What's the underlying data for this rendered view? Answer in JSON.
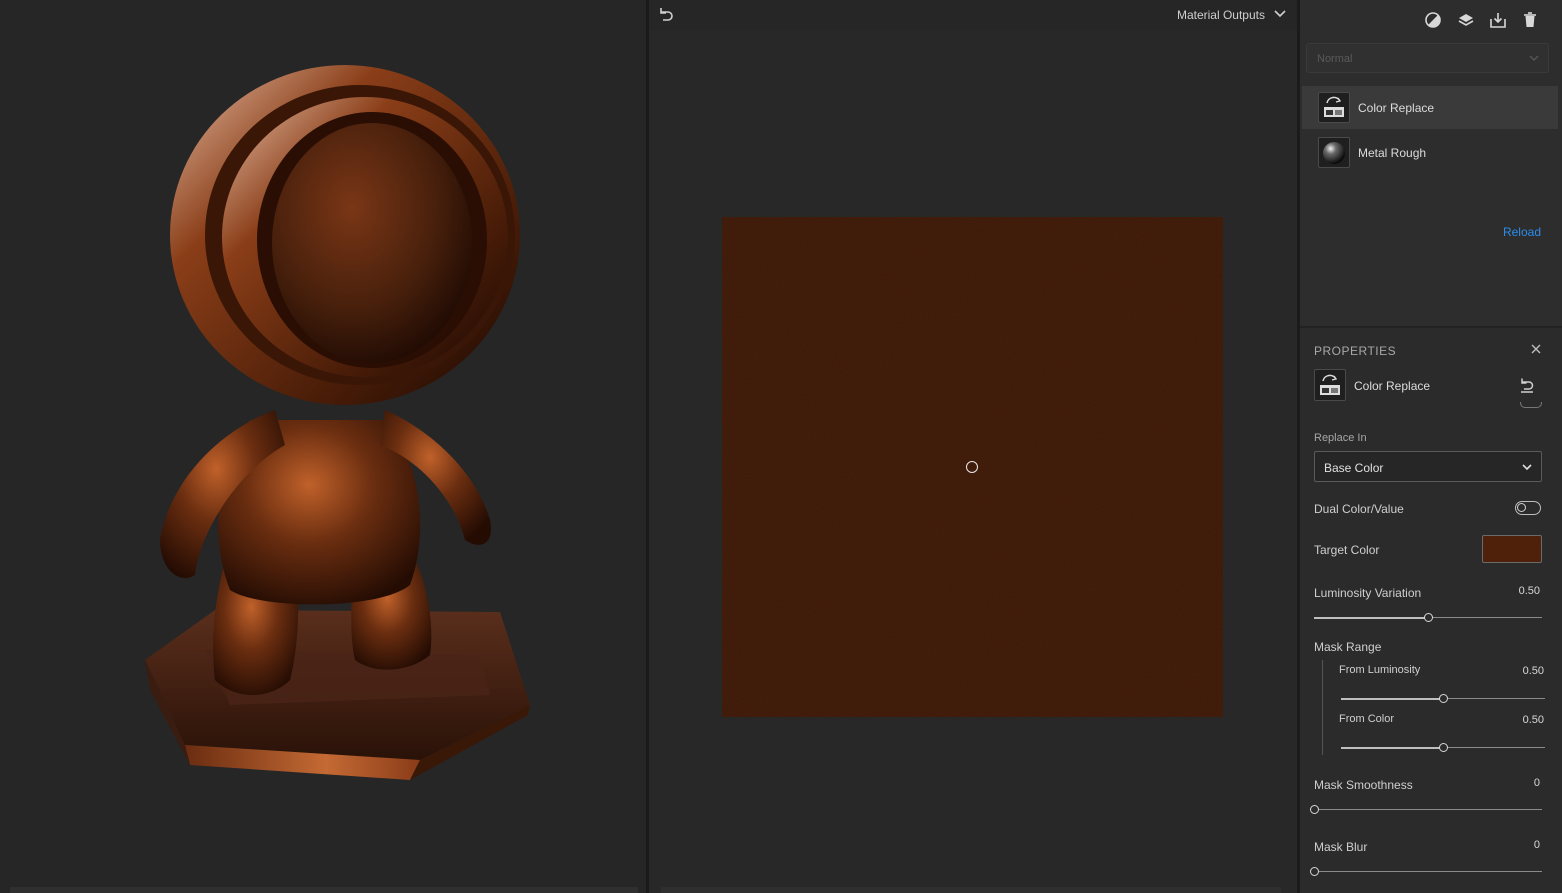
{
  "toolbar_2d": {
    "output_label": "Material Outputs"
  },
  "layers": {
    "blend_mode": "Normal",
    "items": [
      {
        "label": "Color Replace",
        "selected": true
      },
      {
        "label": "Metal Rough",
        "selected": false
      }
    ],
    "reload_label": "Reload"
  },
  "properties": {
    "header": "PROPERTIES",
    "title": "Color Replace",
    "replace_in_label": "Replace In",
    "replace_in_value": "Base Color",
    "dual_color_label": "Dual Color/Value",
    "dual_color_on": false,
    "target_color_label": "Target Color",
    "target_color": "#4f200a",
    "luminosity_variation_label": "Luminosity Variation",
    "luminosity_variation_value": "0.50",
    "mask_range_label": "Mask Range",
    "from_luminosity_label": "From Luminosity",
    "from_luminosity_value": "0.50",
    "from_color_label": "From Color",
    "from_color_value": "0.50",
    "mask_smoothness_label": "Mask Smoothness",
    "mask_smoothness_value": "0",
    "mask_blur_label": "Mask Blur",
    "mask_blur_value": "0"
  },
  "sliders": {
    "luminosity_variation": 0.5,
    "from_luminosity": 0.5,
    "from_color": 0.5,
    "mask_smoothness": 0,
    "mask_blur": 0
  },
  "colors": {
    "material_base": "#4a200c",
    "accent_link": "#2d8ceb"
  },
  "icons": {
    "undo": "undo-icon",
    "outputs_menu": "chevron-down-icon",
    "toolbar": [
      "material-ball-icon",
      "layers-add-icon",
      "export-icon",
      "trash-icon"
    ],
    "close": "close-icon",
    "reset": "reset-icon"
  }
}
